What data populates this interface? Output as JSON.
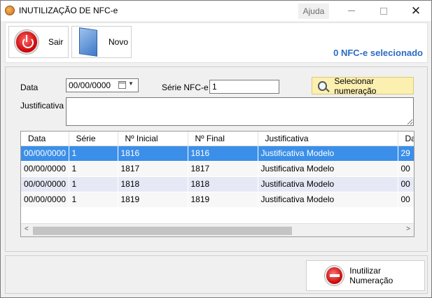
{
  "window": {
    "title": "INUTILIZAÇÃO DE NFC-e",
    "help_label": "Ajuda",
    "close_glyph": "✕"
  },
  "toolbar": {
    "sair_label": "Sair",
    "novo_label": "Novo",
    "selected_count": "0 NFC-e selecionado"
  },
  "form": {
    "data_label": "Data",
    "data_value": "00/00/0000",
    "serie_label": "Série NFC-e",
    "serie_value": "1",
    "justificativa_label": "Justificativa",
    "justificativa_value": "",
    "selecionar_label": "Selecionar numeração"
  },
  "grid": {
    "columns": [
      "Data",
      "Série",
      "Nº Inicial",
      "Nº Final",
      "Justificativa",
      "Da"
    ],
    "rows": [
      [
        "00/00/0000",
        "1",
        "1816",
        "1816",
        "Justificativa Modelo",
        "29"
      ],
      [
        "00/00/0000",
        "1",
        "1817",
        "1817",
        "Justificativa Modelo",
        "00"
      ],
      [
        "00/00/0000",
        "1",
        "1818",
        "1818",
        "Justificativa Modelo",
        "00"
      ],
      [
        "00/00/0000",
        "1",
        "1819",
        "1819",
        "Justificativa Modelo",
        "00"
      ]
    ],
    "scroll_left": "<",
    "scroll_right": ">"
  },
  "footer": {
    "inutilizar_label": "Inutilizar Numeração"
  },
  "icons": {
    "app": "app-icon",
    "sair": "power-icon",
    "novo": "document-icon",
    "selecionar": "magnifier-icon",
    "inutilizar": "no-entry-icon",
    "calendar": "calendar-icon"
  }
}
